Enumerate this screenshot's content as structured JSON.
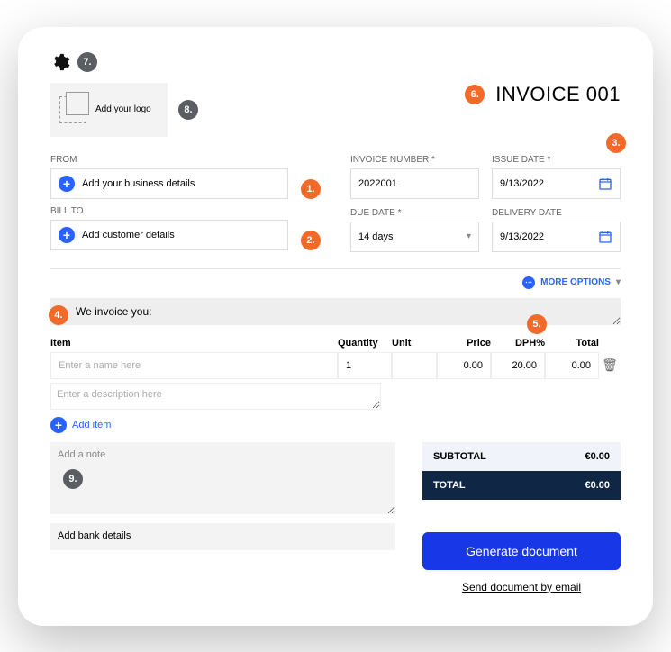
{
  "badges": {
    "b1": "1.",
    "b2": "2.",
    "b3": "3.",
    "b4": "4.",
    "b5": "5.",
    "b6": "6.",
    "b7": "7.",
    "b8": "8.",
    "b9": "9."
  },
  "logo": {
    "text": "Add your logo"
  },
  "title": "INVOICE 001",
  "from": {
    "label": "FROM",
    "placeholder": "Add your business details"
  },
  "billto": {
    "label": "BILL TO",
    "placeholder": "Add customer details"
  },
  "meta": {
    "invoice_no": {
      "label": "Invoice number *",
      "value": "2022001"
    },
    "issue": {
      "label": "Issue date *",
      "value": "9/13/2022"
    },
    "due": {
      "label": "Due date *",
      "value": "14 days"
    },
    "delivery": {
      "label": "Delivery date",
      "value": "9/13/2022"
    }
  },
  "more": "MORE OPTIONS",
  "banner": "We invoice you:",
  "cols": {
    "item": "Item",
    "qty": "Quantity",
    "unit": "Unit",
    "price": "Price",
    "dph": "DPH%",
    "total": "Total"
  },
  "row": {
    "item_ph": "Enter a name here",
    "qty": "1",
    "unit": "",
    "price": "0.00",
    "dph": "20.00",
    "total": "0.00"
  },
  "desc_ph": "Enter a description here",
  "additem": "Add item",
  "note_ph": "Add a note",
  "bank_ph": "Add bank details",
  "totals": {
    "sub_l": "SUBTOTAL",
    "sub_v": "€0.00",
    "tot_l": "TOTAL",
    "tot_v": "€0.00"
  },
  "gen": "Generate document",
  "send": "Send document by email"
}
